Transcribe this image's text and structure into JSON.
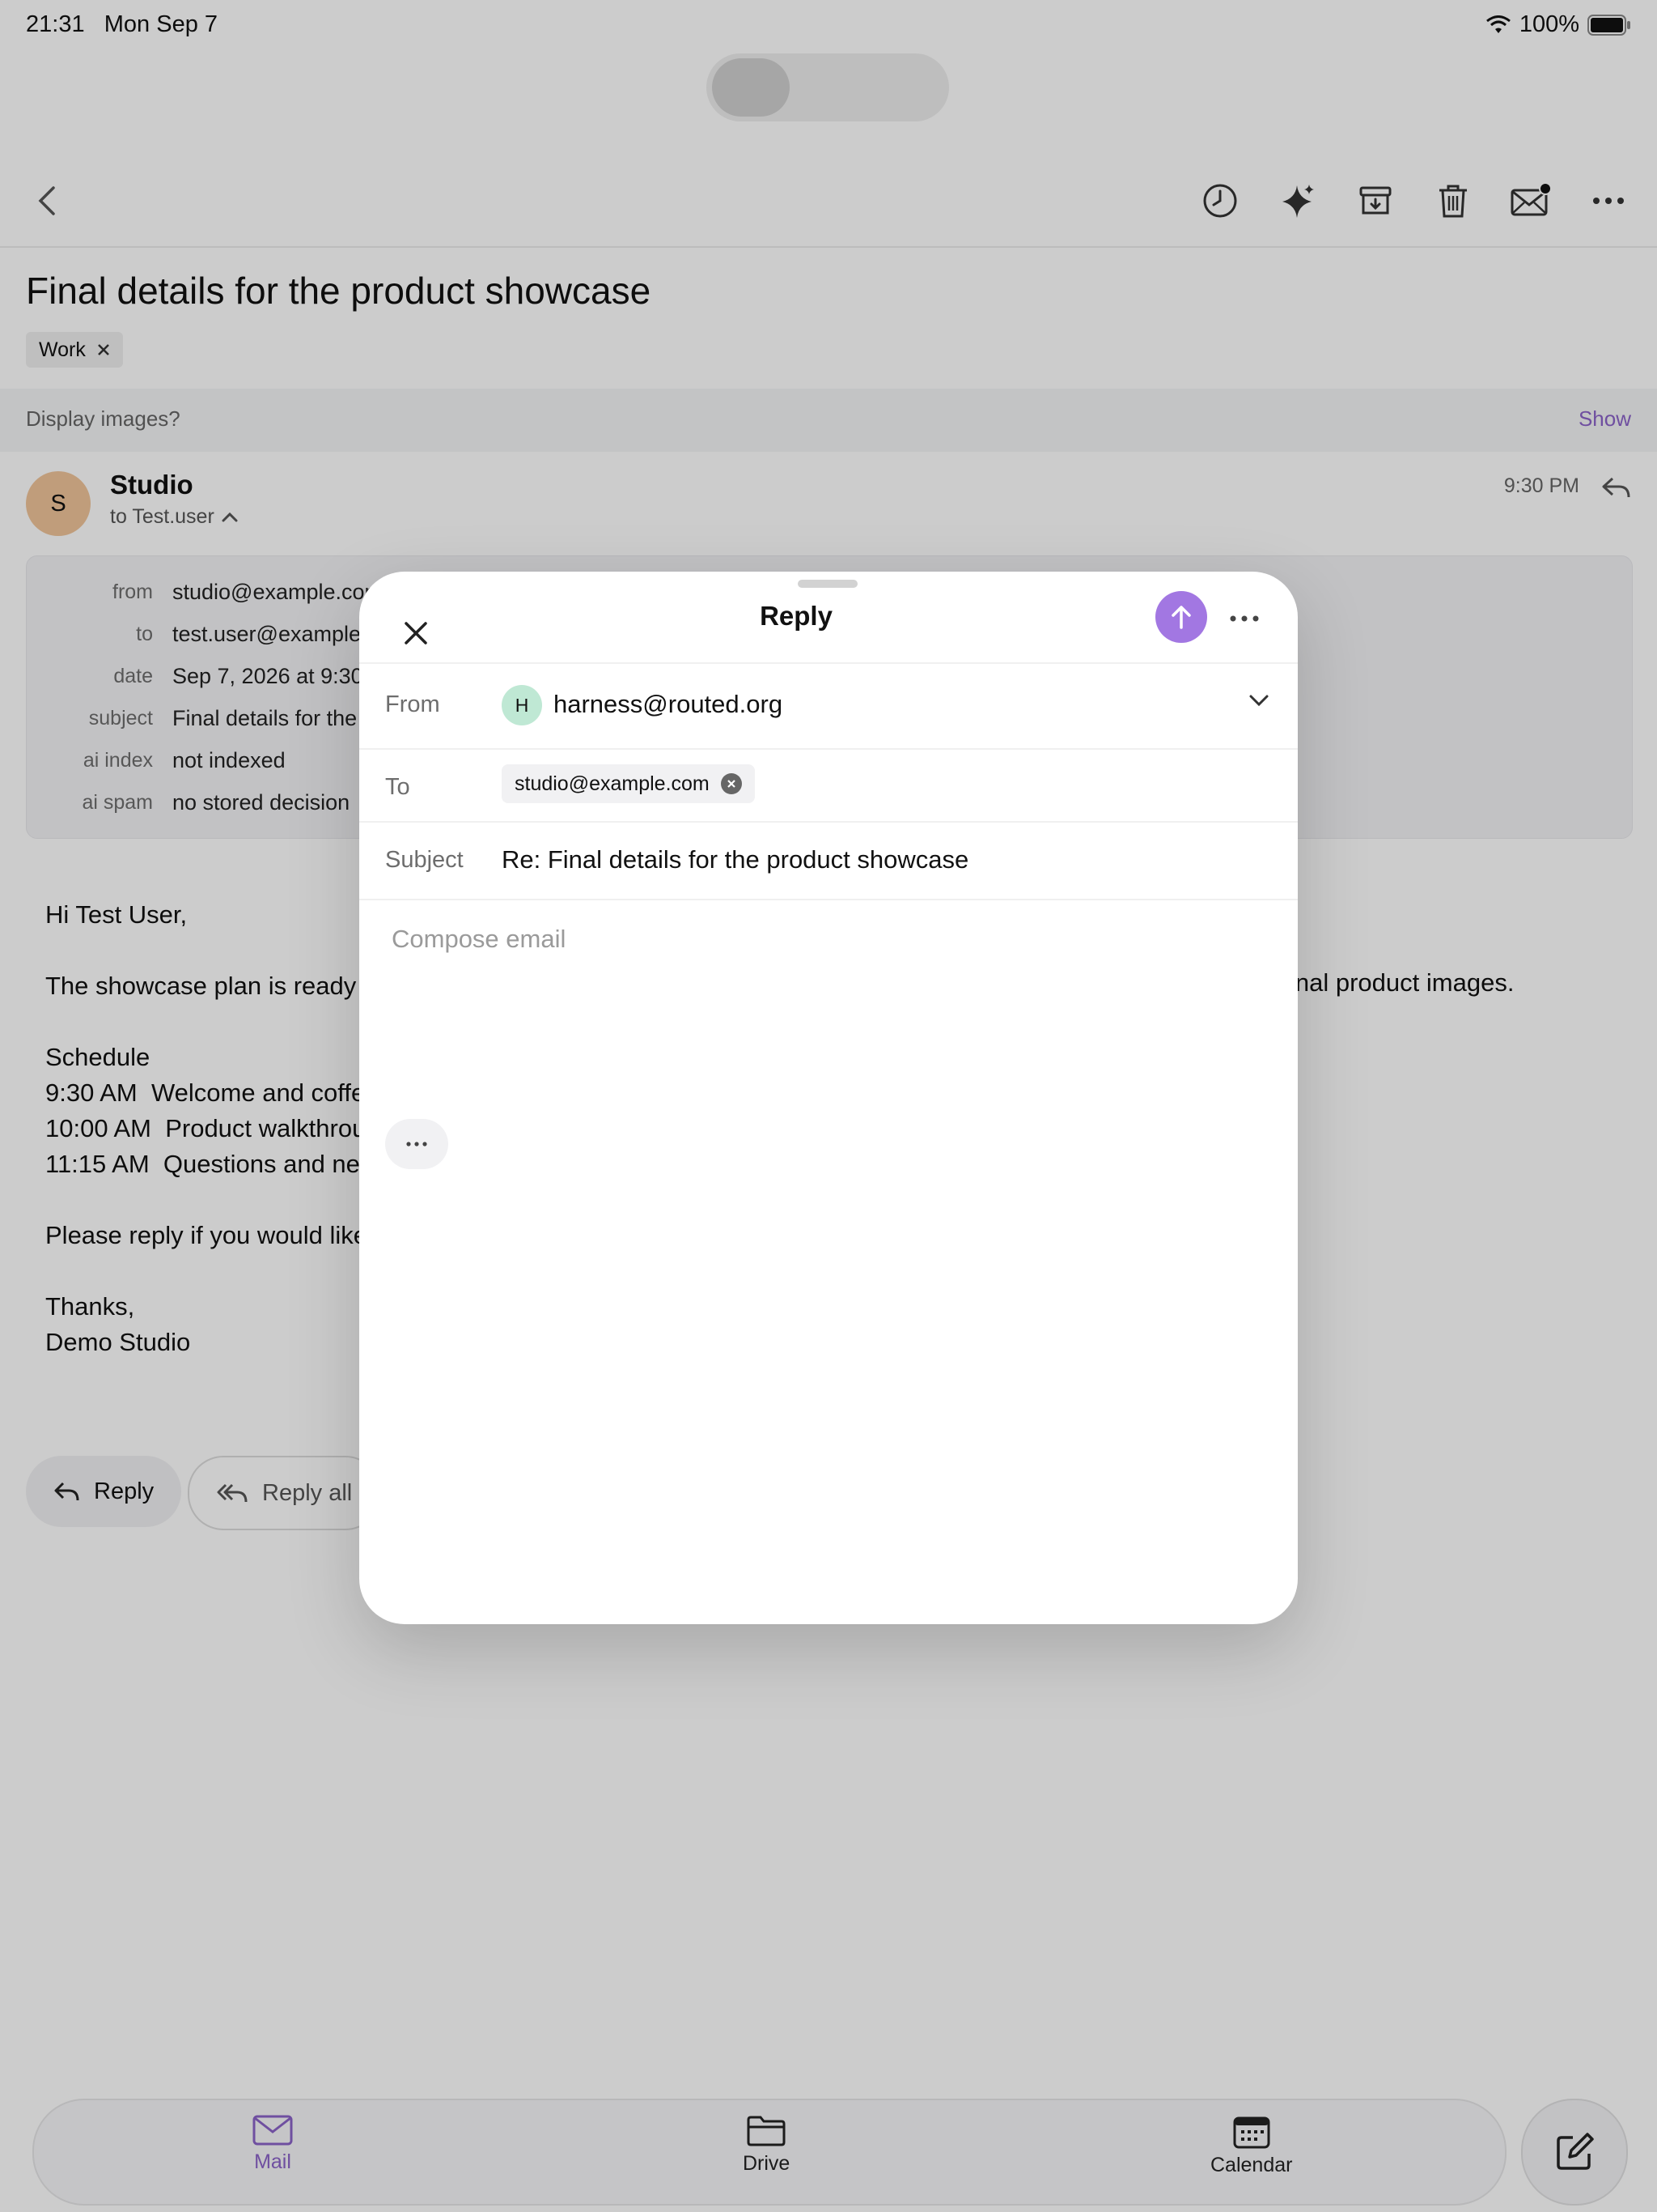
{
  "status_bar": {
    "time": "21:31",
    "date": "Mon Sep 7",
    "battery": "100%"
  },
  "email": {
    "title": "Final details for the product showcase",
    "tag": "Work",
    "images_prompt": "Display images?",
    "images_show": "Show",
    "sender": {
      "initial": "S",
      "name": "Studio",
      "to": "to Test.user",
      "time": "9:30 PM"
    },
    "details": [
      {
        "key": "from",
        "value": "studio@example.com"
      },
      {
        "key": "to",
        "value": "test.user@example"
      },
      {
        "key": "date",
        "value": "Sep 7, 2026 at 9:30"
      },
      {
        "key": "subject",
        "value": "Final details for the"
      },
      {
        "key": "ai index",
        "value": "not indexed"
      },
      {
        "key": "ai spam",
        "value": "no stored decision"
      }
    ],
    "body": {
      "greeting": "Hi Test User,",
      "intro": "The showcase plan is ready",
      "intro_cont": "inal product images.",
      "schedule_title": "Schedule",
      "schedule": [
        "9:30 AM  Welcome and coffe",
        "10:00 AM  Product walkthrou",
        "11:15 AM  Questions and nex"
      ],
      "request": "Please reply if you would like",
      "signoff": "Thanks,",
      "signature": "Demo Studio"
    },
    "actions": {
      "reply": "Reply",
      "reply_all": "Reply all"
    }
  },
  "tabs": [
    {
      "label": "Mail",
      "active": true
    },
    {
      "label": "Drive",
      "active": false
    },
    {
      "label": "Calendar",
      "active": false
    }
  ],
  "modal": {
    "title": "Reply",
    "from_label": "From",
    "from_initial": "H",
    "from_value": "harness@routed.org",
    "to_label": "To",
    "to_chip": "studio@example.com",
    "subject_label": "Subject",
    "subject_value": "Re: Final details for the product showcase",
    "compose_placeholder": "Compose email"
  },
  "colors": {
    "accent": "#8b63c9",
    "send": "#a277e2",
    "avatar_sender": "#f0c59a",
    "avatar_from": "#bfe8d4"
  }
}
